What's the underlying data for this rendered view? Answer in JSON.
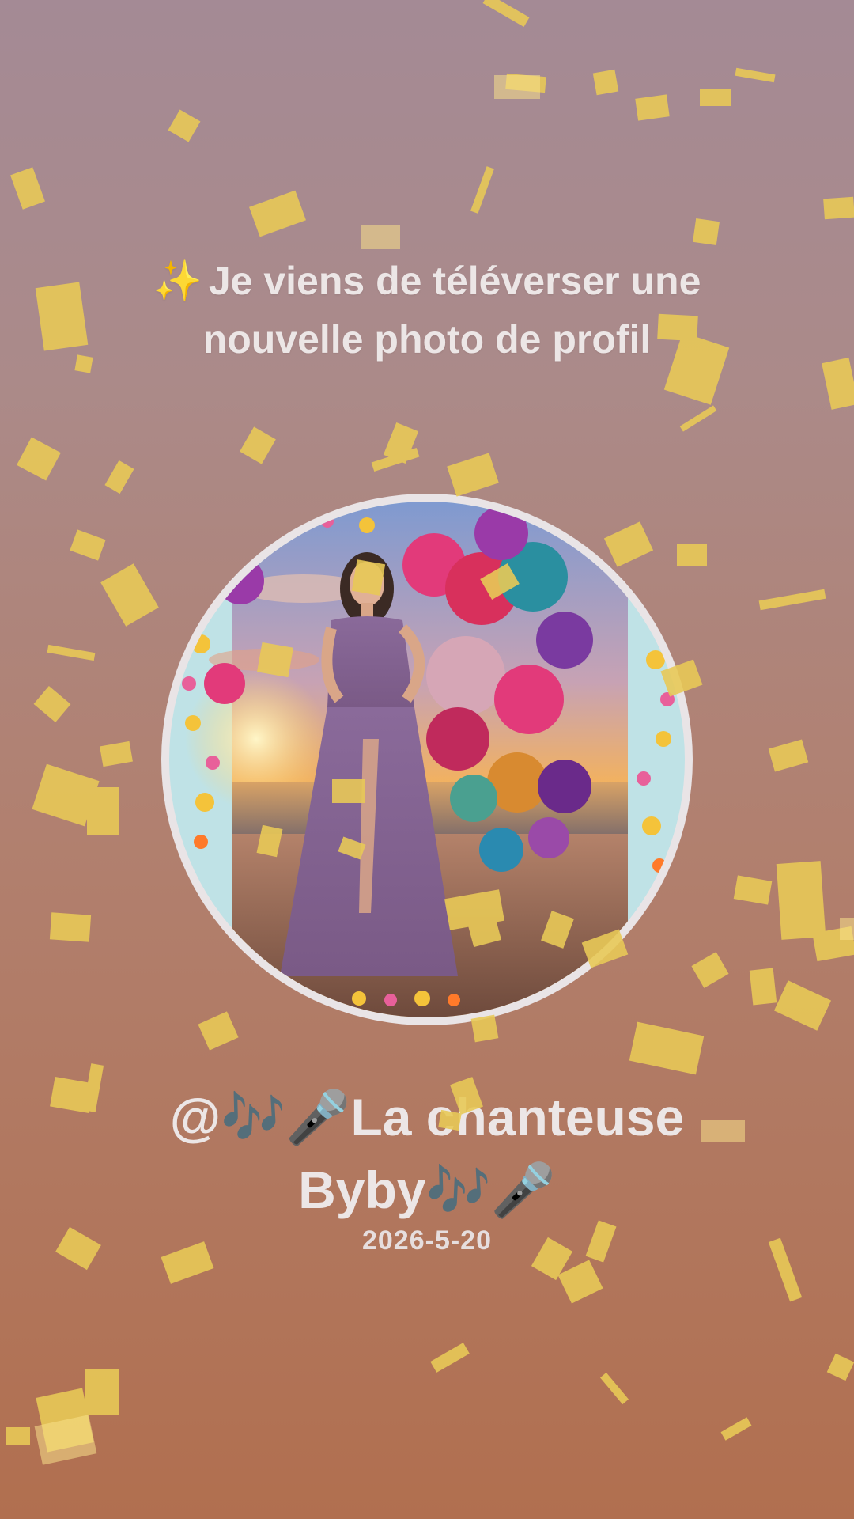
{
  "announcement": {
    "sparkle_icon": "✨",
    "text": "Je viens de téléverser une nouvelle photo de profil"
  },
  "profile": {
    "photo": "profile-photo",
    "username": "@🎶🎤La chanteuse Byby🎶🎤",
    "date": "2026-5-20"
  },
  "colors": {
    "background_top": "#a48a95",
    "background_bottom": "#b16f4f",
    "text": "#ece6e6",
    "confetti": "#e8c957",
    "avatar_ring": "#e9e4e6"
  },
  "decoration": "gold-confetti"
}
